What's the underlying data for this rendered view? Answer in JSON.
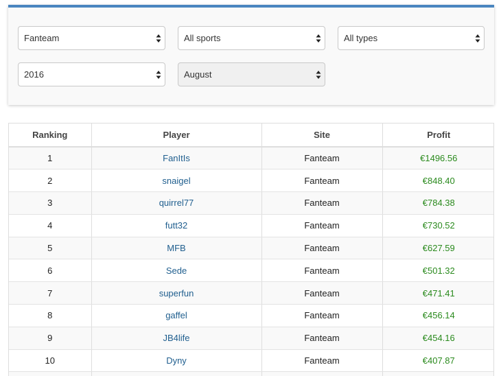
{
  "filters": {
    "site": "Fanteam",
    "sport": "All sports",
    "type": "All types",
    "year": "2016",
    "month": "August"
  },
  "table": {
    "headers": [
      "Ranking",
      "Player",
      "Site",
      "Profit"
    ],
    "rows": [
      {
        "rank": "1",
        "player": "FanItIs",
        "site": "Fanteam",
        "profit": "€1496.56"
      },
      {
        "rank": "2",
        "player": "snaigel",
        "site": "Fanteam",
        "profit": "€848.40"
      },
      {
        "rank": "3",
        "player": "quirrel77",
        "site": "Fanteam",
        "profit": "€784.38"
      },
      {
        "rank": "4",
        "player": "futt32",
        "site": "Fanteam",
        "profit": "€730.52"
      },
      {
        "rank": "5",
        "player": "MFB",
        "site": "Fanteam",
        "profit": "€627.59"
      },
      {
        "rank": "6",
        "player": "Sede",
        "site": "Fanteam",
        "profit": "€501.32"
      },
      {
        "rank": "7",
        "player": "superfun",
        "site": "Fanteam",
        "profit": "€471.41"
      },
      {
        "rank": "8",
        "player": "gaffel",
        "site": "Fanteam",
        "profit": "€456.14"
      },
      {
        "rank": "9",
        "player": "JB4life",
        "site": "Fanteam",
        "profit": "€454.16"
      },
      {
        "rank": "10",
        "player": "Dyny",
        "site": "Fanteam",
        "profit": "€407.87"
      }
    ]
  },
  "icons": {
    "select_arrow": "sort-arrows-icon"
  },
  "colors": {
    "accent": "#4a86c0",
    "player_link": "#1f5e8e",
    "profit": "#2a8a1d"
  }
}
